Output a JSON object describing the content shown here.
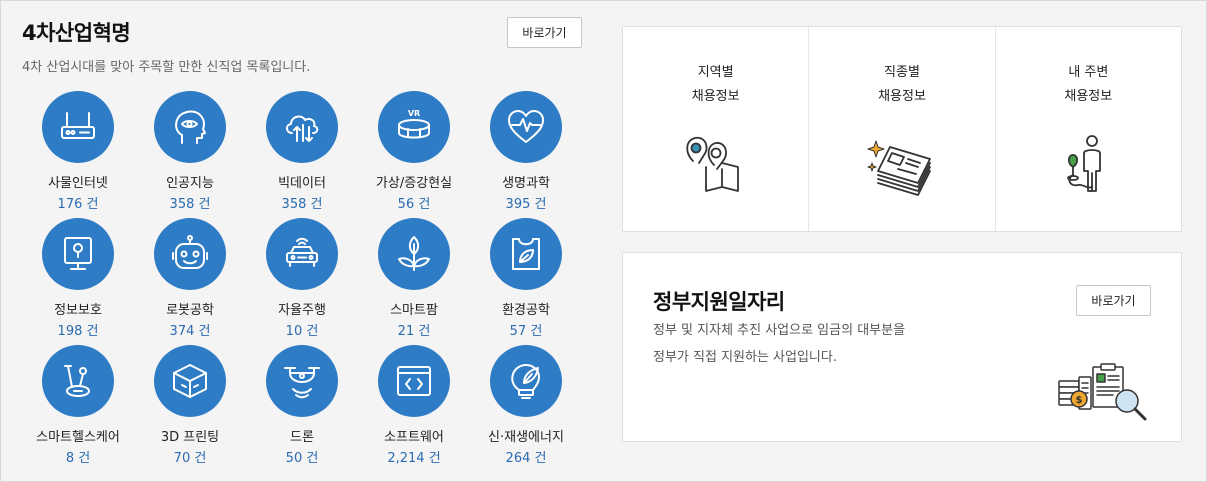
{
  "industry": {
    "title": "4차산업혁명",
    "subtitle": "4차 산업시대를 맞아 주목할 만한 신직업 목록입니다.",
    "goto_label": "바로가기",
    "categories": [
      {
        "label": "사물인터넷",
        "count": "176 건",
        "icon": "router-icon"
      },
      {
        "label": "인공지능",
        "count": "358 건",
        "icon": "ai-head-icon"
      },
      {
        "label": "빅데이터",
        "count": "358 건",
        "icon": "cloud-data-icon"
      },
      {
        "label": "가상/증강현실",
        "count": "56 건",
        "icon": "vr-headset-icon"
      },
      {
        "label": "생명과학",
        "count": "395 건",
        "icon": "heartbeat-icon"
      },
      {
        "label": "정보보호",
        "count": "198 건",
        "icon": "lock-monitor-icon"
      },
      {
        "label": "로봇공학",
        "count": "374 건",
        "icon": "robot-icon"
      },
      {
        "label": "자율주행",
        "count": "10 건",
        "icon": "self-driving-car-icon"
      },
      {
        "label": "스마트팜",
        "count": "21 건",
        "icon": "sprout-icon"
      },
      {
        "label": "환경공학",
        "count": "57 건",
        "icon": "eco-bag-icon"
      },
      {
        "label": "스마트헬스케어",
        "count": "8 건",
        "icon": "exercise-bike-icon"
      },
      {
        "label": "3D 프린팅",
        "count": "70 건",
        "icon": "3d-cube-icon"
      },
      {
        "label": "드론",
        "count": "50 건",
        "icon": "drone-icon"
      },
      {
        "label": "소프트웨어",
        "count": "2,214 건",
        "icon": "code-window-icon"
      },
      {
        "label": "신·재생에너지",
        "count": "264 건",
        "icon": "leaf-bulb-icon"
      }
    ]
  },
  "jobs": {
    "cells": [
      {
        "line1": "지역별",
        "line2": "채용정보",
        "icon": "map-pin-icon"
      },
      {
        "line1": "직종별",
        "line2": "채용정보",
        "icon": "newspaper-stack-icon"
      },
      {
        "line1": "내 주변",
        "line2": "채용정보",
        "icon": "person-location-icon"
      }
    ]
  },
  "gov": {
    "title": "정부지원일자리",
    "desc_line1": "정부 및 지자체 추진 사업으로 임금의 대부분을",
    "desc_line2": "정부가 직접 지원하는 사업입니다.",
    "goto_label": "바로가기",
    "icon": "money-document-search-icon"
  },
  "colors": {
    "accent_blue": "#2f7cc6",
    "count_blue": "#2b6bb0",
    "icon_teal": "#3a8fb8",
    "icon_green": "#4aa04a",
    "icon_orange": "#f0a830"
  }
}
